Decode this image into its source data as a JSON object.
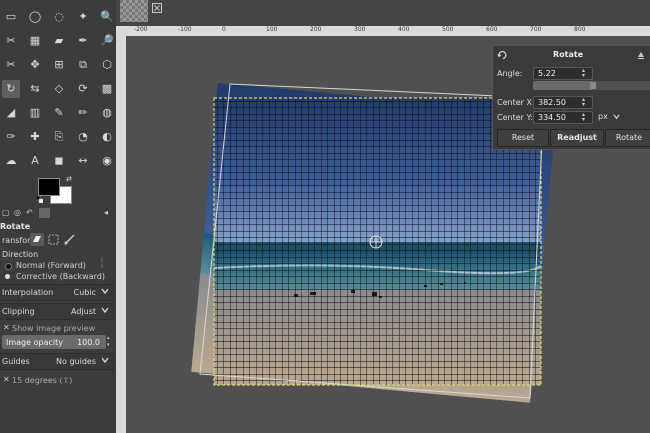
{
  "tool_options": {
    "title": "Rotate",
    "transform_label": "ransform:",
    "direction_label": "Direction",
    "normal_label": "Normal (Forward)",
    "corrective_label": "Corrective (Backward)",
    "interpolation_label": "Interpolation",
    "interpolation_value": "Cubic",
    "clipping_label": "Clipping",
    "clipping_value": "Adjust",
    "show_preview_label": "Show image preview",
    "opacity_label": "Image opacity",
    "opacity_value": "100.0",
    "guides_label": "Guides",
    "guides_value": "No guides",
    "snap_label": "15 degrees (⇧)"
  },
  "ruler": {
    "labels": [
      "-200",
      "-100",
      "0",
      "100",
      "200",
      "300",
      "400",
      "500",
      "600",
      "700",
      "800"
    ]
  },
  "dialog": {
    "title": "Rotate",
    "angle_label": "Angle:",
    "angle_value": "5.22",
    "angle_slider_fraction": 0.51,
    "center_x_label": "Center X:",
    "center_x_value": "382.50",
    "center_y_label": "Center Y:",
    "center_y_value": "334.50",
    "unit": "px",
    "reset_label": "Reset",
    "readjust_label": "Readjust",
    "rotate_label": "Rotate"
  },
  "icons": [
    "rect-select-icon",
    "ellipse-select-icon",
    "lasso-icon",
    "fuzzy-select-icon",
    "move-icon",
    "align-icon",
    "crop-icon",
    "rotate-icon",
    "paint-icon",
    "eraser-icon",
    "swap-colors-icon",
    "reset-colors-icon",
    "close-icon",
    "chevron-down-icon"
  ]
}
